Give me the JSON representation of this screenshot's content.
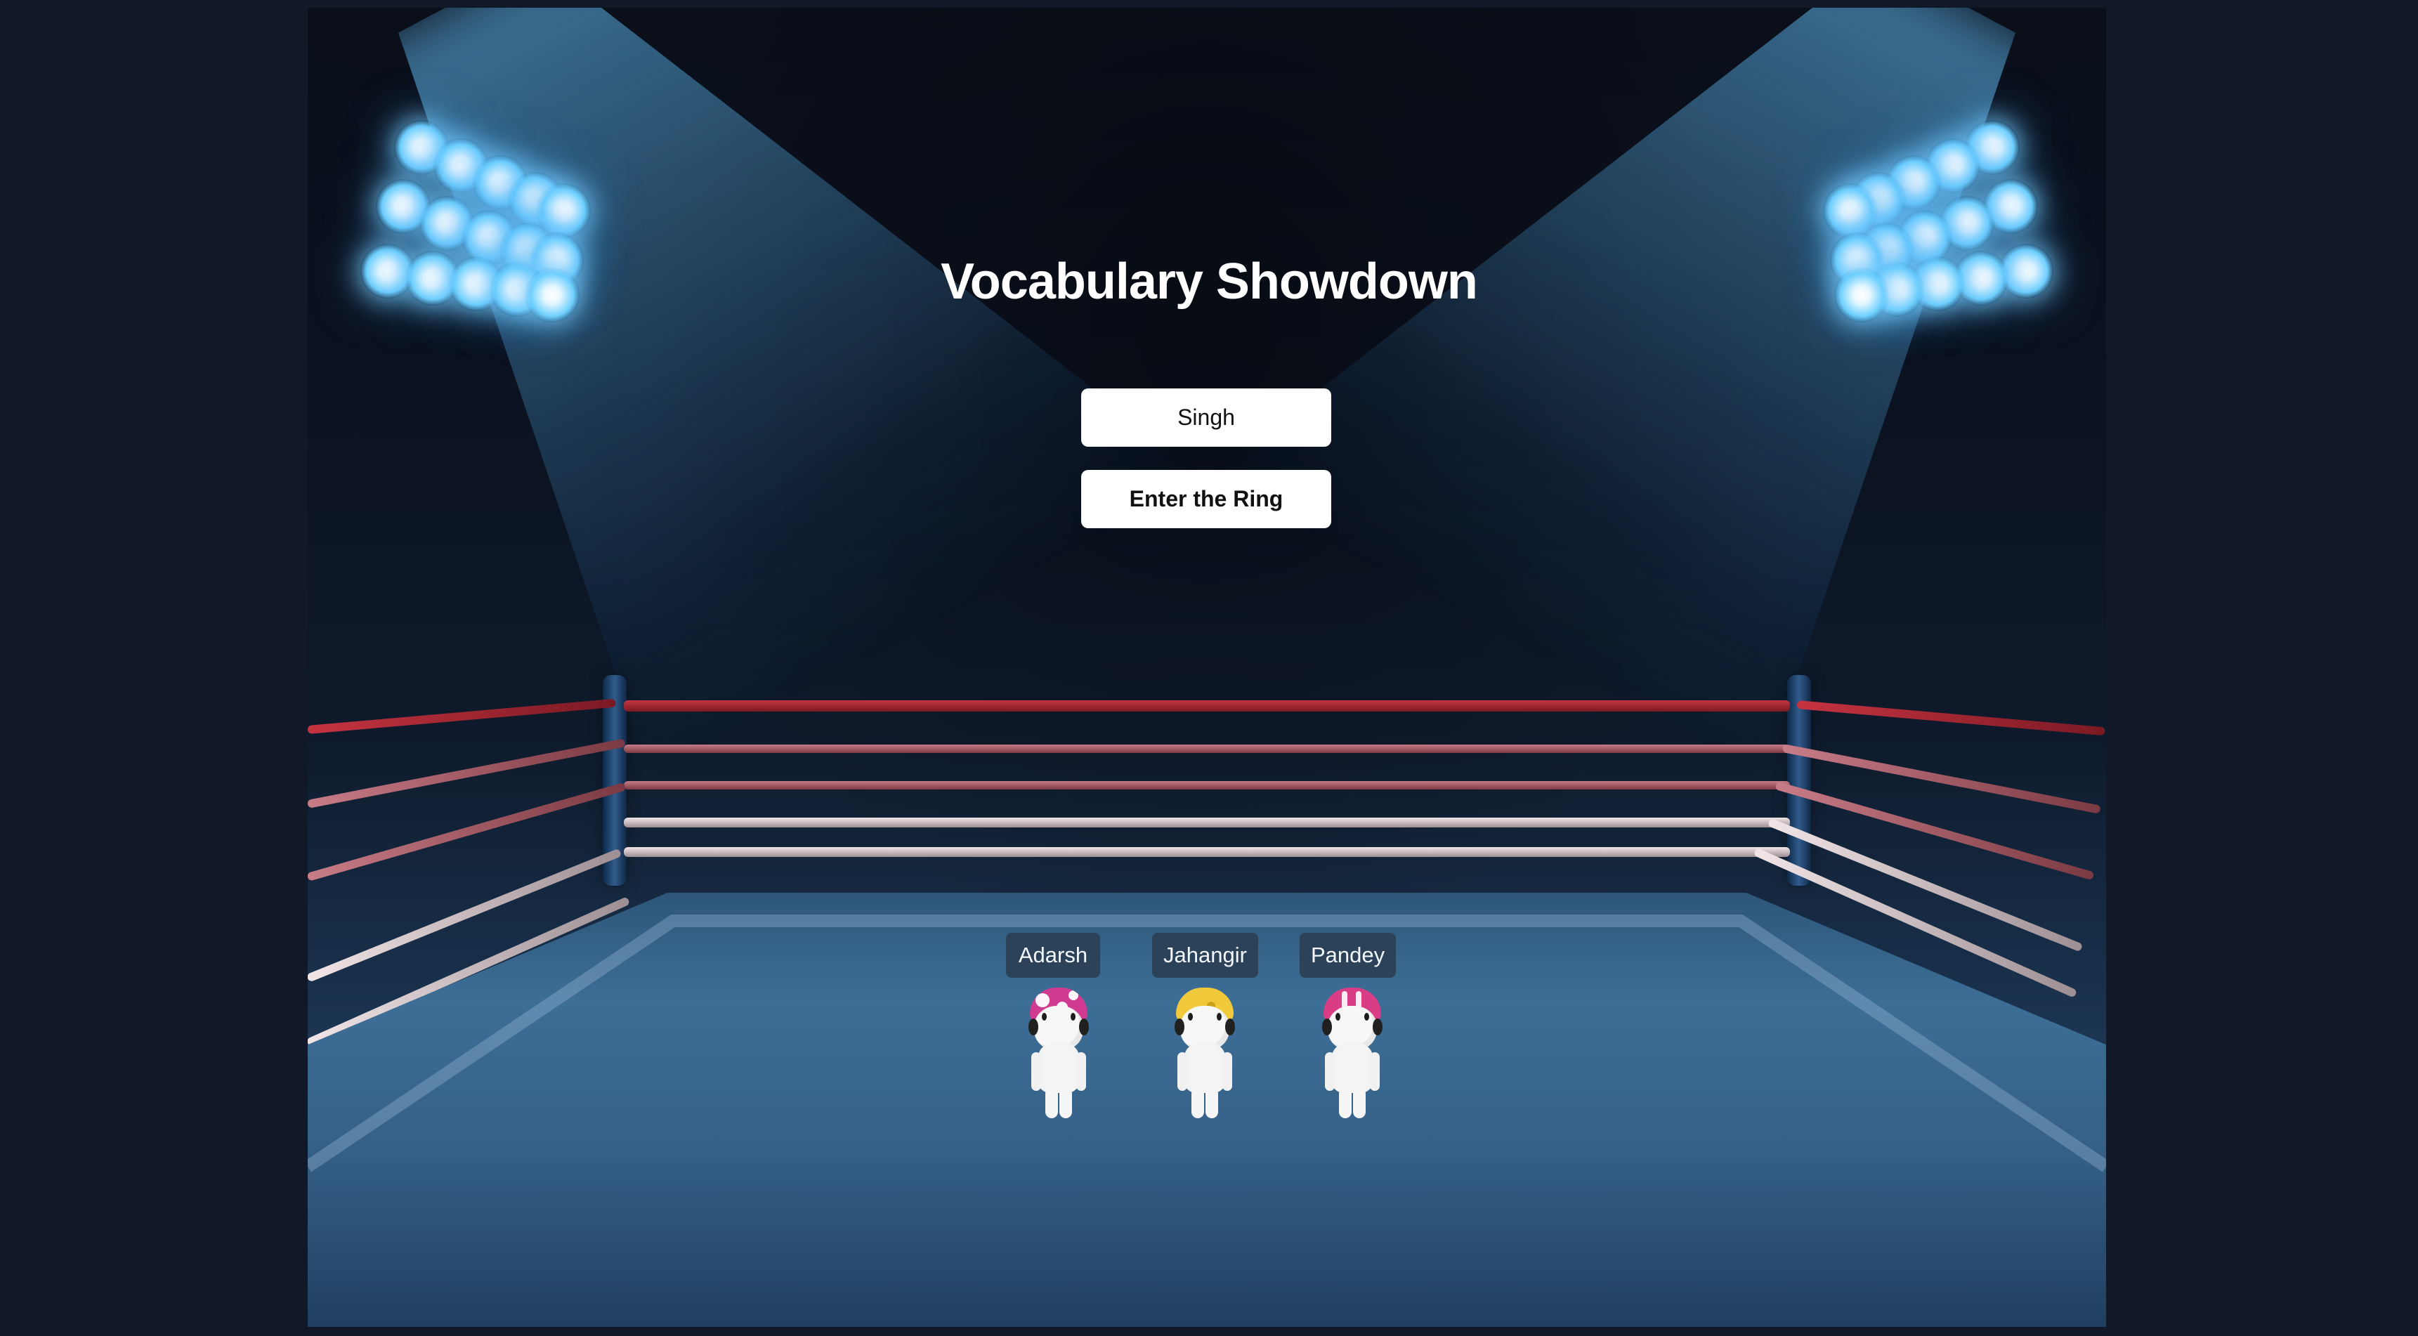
{
  "page": {
    "title": "Vocabulary Showdown"
  },
  "controls": {
    "name_value": "Singh",
    "enter_button_label": "Enter the Ring"
  },
  "players": [
    {
      "name": "Adarsh",
      "helmet_color": "#d03a90"
    },
    {
      "name": "Jahangir",
      "helmet_color": "#f0ca3a"
    },
    {
      "name": "Pandey",
      "helmet_color": "#d83d86"
    }
  ],
  "colors": {
    "page_background": "#111827",
    "button_background": "#ffffff",
    "badge_background": "#2b4259"
  }
}
